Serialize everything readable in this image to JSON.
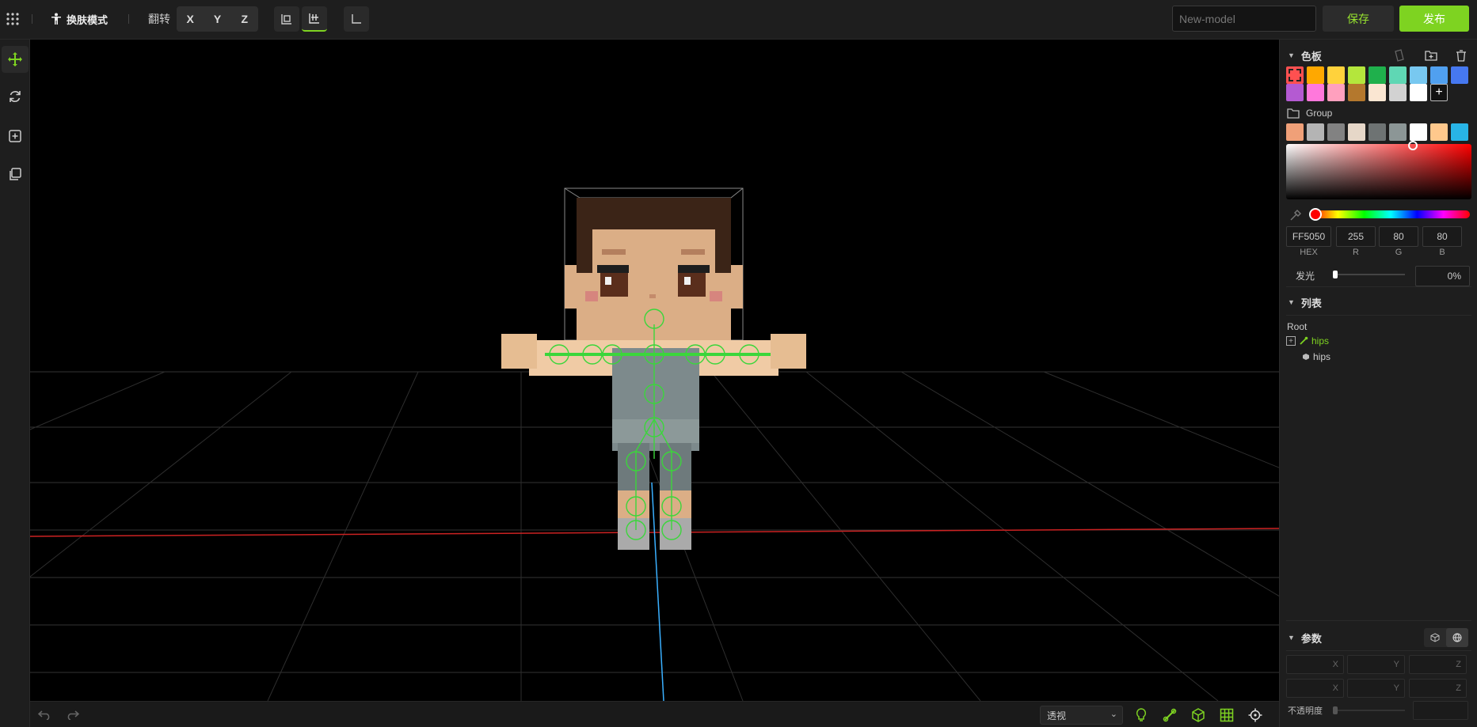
{
  "toolbar": {
    "mode_label": "换肤模式",
    "flip_label": "翻转",
    "axes": [
      "X",
      "Y",
      "Z"
    ],
    "model_name_placeholder": "New-model",
    "save_label": "保存",
    "publish_label": "发布"
  },
  "palette": {
    "title": "色板",
    "row1": [
      "#ff5050",
      "#ffa800",
      "#ffd23c",
      "#b4e63c",
      "#1fb04c",
      "#5fd7b4",
      "#78c8f0",
      "#50a0f0",
      "#4678f0"
    ],
    "row2": [
      "#b45ad2",
      "#ff78dc",
      "#ffa0be",
      "#b4782d",
      "#fae6d2",
      "#d2d2d2",
      "#ffffff"
    ],
    "add_label": "+",
    "group_label": "Group",
    "group_colors": [
      "#f0a078",
      "#b4b4b4",
      "#828282",
      "#e6d7c8",
      "#6e7373",
      "#8c9696",
      "#ffffff",
      "#ffc88c",
      "#28b4e6"
    ]
  },
  "color": {
    "hex": "FF5050",
    "r": "255",
    "g": "80",
    "b": "80",
    "hex_label": "HEX",
    "r_label": "R",
    "g_label": "G",
    "b_label": "B",
    "glow_label": "发光",
    "glow_value": "0%"
  },
  "list": {
    "title": "列表",
    "root_label": "Root",
    "bone_label": "hips",
    "mesh_label": "hips"
  },
  "params": {
    "title": "参数",
    "row_axes": [
      "X",
      "Y",
      "Z"
    ],
    "opacity_label": "不透明度"
  },
  "viewport": {
    "view_mode": "透视"
  }
}
